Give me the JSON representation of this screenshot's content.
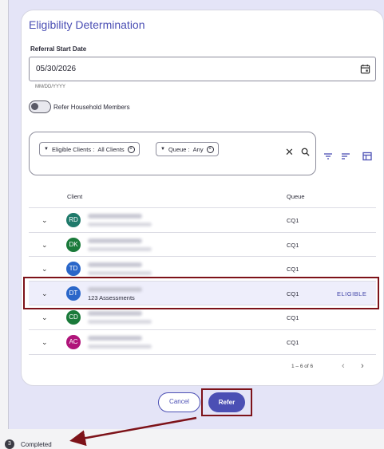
{
  "form": {
    "title": "Eligibility Determination",
    "date_label": "Referral Start Date",
    "date_value": "05/30/2026",
    "date_helper": "MM/DD/YYYY",
    "toggle_label": "Refer Household Members"
  },
  "filters": {
    "chips": [
      {
        "label": "Eligible Clients :",
        "value": "All Clients"
      },
      {
        "label": "Queue :",
        "value": "Any"
      }
    ]
  },
  "table": {
    "columns": {
      "client": "Client",
      "queue": "Queue"
    },
    "rows": [
      {
        "initials": "RD",
        "avatar_color": "#1f7a6b",
        "queue": "CQ1"
      },
      {
        "initials": "DK",
        "avatar_color": "#1a7a3a",
        "queue": "CQ1"
      },
      {
        "initials": "TD",
        "avatar_color": "#2a66c9",
        "queue": "CQ1"
      },
      {
        "initials": "DT",
        "avatar_color": "#2a66c9",
        "queue": "CQ1",
        "subtitle": "123 Assessments",
        "status": "ELIGIBLE"
      },
      {
        "initials": "CD",
        "avatar_color": "#1a7a3a",
        "queue": "CQ1"
      },
      {
        "initials": "AC",
        "avatar_color": "#b0147a",
        "queue": "CQ1"
      }
    ],
    "pagination": "1 – 6 of 6"
  },
  "actions": {
    "cancel": "Cancel",
    "refer": "Refer"
  },
  "status": {
    "step": "3",
    "text": "Completed"
  },
  "colors": {
    "accent": "#4b4fb4",
    "highlight": "#7d1219"
  }
}
